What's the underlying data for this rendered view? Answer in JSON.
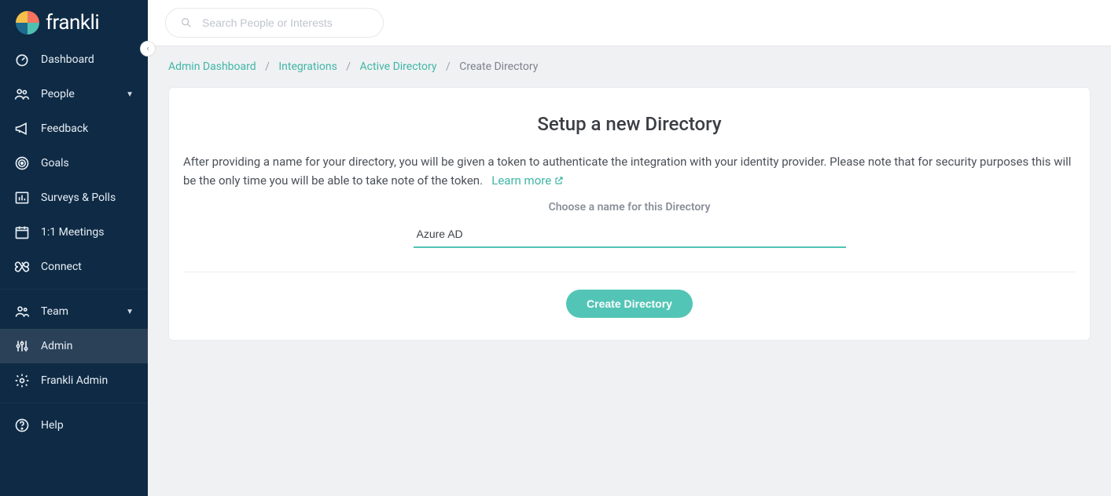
{
  "brand": "frankli",
  "search": {
    "placeholder": "Search People or Interests"
  },
  "sidebar": {
    "items": {
      "dashboard": "Dashboard",
      "people": "People",
      "feedback": "Feedback",
      "goals": "Goals",
      "surveys": "Surveys & Polls",
      "meetings": "1:1 Meetings",
      "connect": "Connect",
      "team": "Team",
      "admin": "Admin",
      "frankli_admin": "Frankli Admin",
      "help": "Help"
    }
  },
  "breadcrumb": {
    "admin_dashboard": "Admin Dashboard",
    "integrations": "Integrations",
    "active_directory": "Active Directory",
    "current": "Create Directory"
  },
  "card": {
    "title": "Setup a new Directory",
    "description": "After providing a name for your directory, you will be given a token to authenticate the integration with your identity provider. Please note that for security purposes this will be the only time you will be able to take note of the token.",
    "learn_more": "Learn more",
    "field_label": "Choose a name for this Directory",
    "field_value": "Azure AD",
    "submit": "Create Directory"
  }
}
